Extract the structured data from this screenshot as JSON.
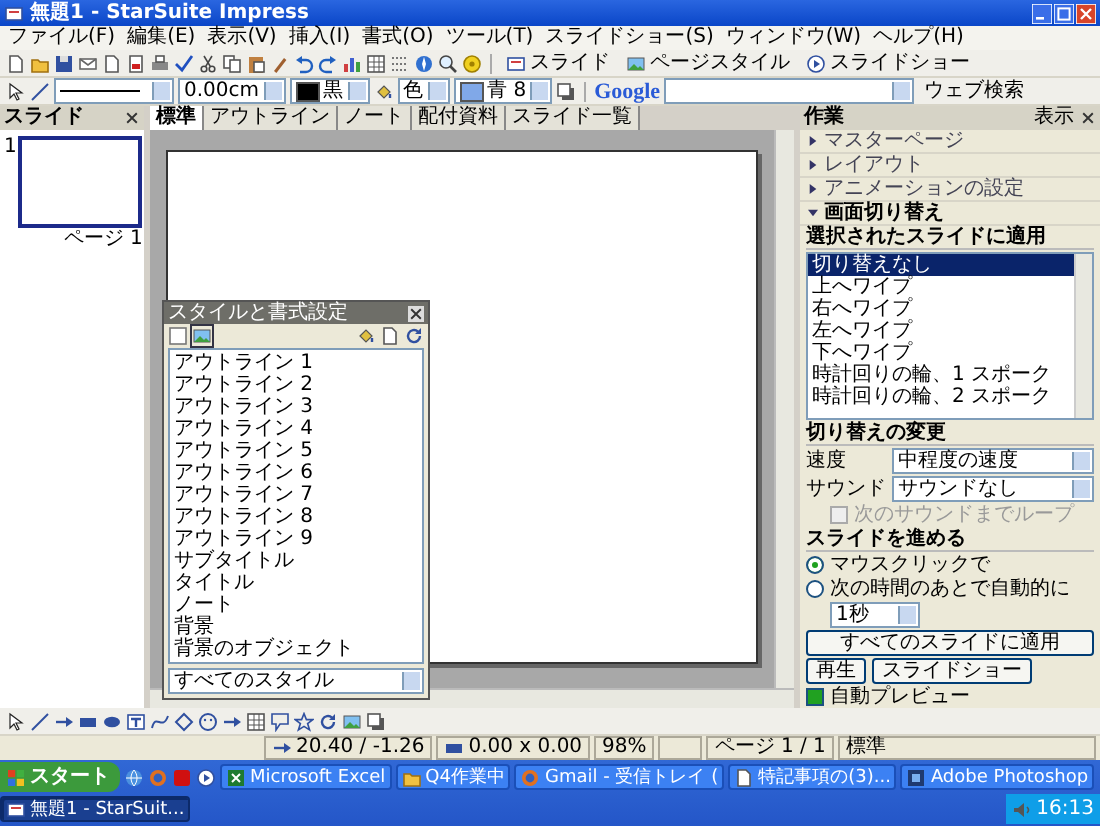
{
  "window": {
    "title": "無題1 - StarSuite Impress"
  },
  "menu": [
    "ファイル(F)",
    "編集(E)",
    "表示(V)",
    "挿入(I)",
    "書式(O)",
    "ツール(T)",
    "スライドショー(S)",
    "ウィンドウ(W)",
    "ヘルプ(H)"
  ],
  "toolbar": {
    "buttons": [
      "スライド",
      "ページスタイル",
      "スライドショー"
    ]
  },
  "line_toolbar": {
    "line_width": "0.00cm",
    "line_color": "黒",
    "area_style": "色",
    "area_color": "青 8"
  },
  "google_bar": {
    "logo": "Google",
    "button": "ウェブ検索"
  },
  "slides_pane": {
    "title": "スライド",
    "slides": [
      {
        "number": "1",
        "label": "ページ 1",
        "selected": true
      }
    ]
  },
  "view_tabs": [
    {
      "label": "標準",
      "selected": true
    },
    {
      "label": "アウトライン",
      "selected": false
    },
    {
      "label": "ノート",
      "selected": false
    },
    {
      "label": "配付資料",
      "selected": false
    },
    {
      "label": "スライド一覧",
      "selected": false
    }
  ],
  "styles_window": {
    "title": "スタイルと書式設定",
    "styles": [
      "アウトライン 1",
      "アウトライン 2",
      "アウトライン 3",
      "アウトライン 4",
      "アウトライン 5",
      "アウトライン 6",
      "アウトライン 7",
      "アウトライン 8",
      "アウトライン 9",
      "サブタイトル",
      "タイトル",
      "ノート",
      "背景",
      "背景のオブジェクト"
    ],
    "filter": "すべてのスタイル"
  },
  "task_pane": {
    "title": "作業",
    "view_menu": "表示",
    "sections": [
      {
        "label": "マスターページ",
        "expanded": false
      },
      {
        "label": "レイアウト",
        "expanded": false
      },
      {
        "label": "アニメーションの設定",
        "expanded": false
      },
      {
        "label": "画面切り替え",
        "expanded": true
      }
    ],
    "apply_label": "選択されたスライドに適用",
    "transitions": [
      {
        "label": "切り替えなし",
        "selected": true
      },
      {
        "label": "上へワイプ",
        "selected": false
      },
      {
        "label": "右へワイプ",
        "selected": false
      },
      {
        "label": "左へワイプ",
        "selected": false
      },
      {
        "label": "下へワイプ",
        "selected": false
      },
      {
        "label": "時計回りの輪、1 スポーク",
        "selected": false
      },
      {
        "label": "時計回りの輪、2 スポーク",
        "selected": false
      }
    ],
    "modify_label": "切り替えの変更",
    "speed": {
      "label": "速度",
      "value": "中程度の速度"
    },
    "sound": {
      "label": "サウンド",
      "value": "サウンドなし"
    },
    "loop": {
      "label": "次のサウンドまでループ",
      "checked": false,
      "disabled": true
    },
    "advance_label": "スライドを進める",
    "advance_options": [
      {
        "label": "マウスクリックで",
        "selected": true
      },
      {
        "label": "次の時間のあとで自動的に",
        "selected": false
      }
    ],
    "delay": "1秒",
    "apply_all": "すべてのスライドに適用",
    "play": "再生",
    "slideshow": "スライドショー",
    "auto_preview": {
      "label": "自動プレビュー",
      "checked": true
    }
  },
  "status_bar": {
    "position": "20.40 / -1.26",
    "size": "0.00 x 0.00",
    "zoom": "98%",
    "page": "ページ 1 / 1",
    "layout": "標準"
  },
  "taskbar": {
    "start": "スタート",
    "tasks": [
      {
        "label": "Microsoft Excel",
        "selected": false
      },
      {
        "label": "Q4作業中",
        "selected": false
      },
      {
        "label": "Gmail - 受信トレイ (",
        "selected": false
      },
      {
        "label": "特記事項の(3)...",
        "selected": false
      },
      {
        "label": "Adobe Photoshop",
        "selected": false
      },
      {
        "label": "無題1 - StarSuit...",
        "selected": true
      }
    ],
    "clock": "16:13"
  }
}
